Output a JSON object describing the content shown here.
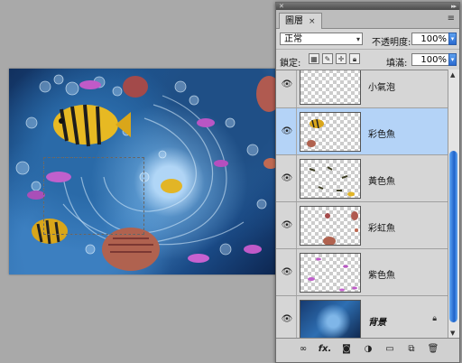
{
  "panel": {
    "tab_label": "圖層",
    "tab_close": "×",
    "menu_icon": "≡",
    "blend_mode": "正常",
    "opacity_label": "不透明度:",
    "opacity_value": "100%",
    "lock_label": "鎖定:",
    "fill_label": "填滿:",
    "fill_value": "100%"
  },
  "layers": [
    {
      "name": "小氣泡",
      "visible": true,
      "selected": false,
      "type": "transparent"
    },
    {
      "name": "彩色魚",
      "visible": true,
      "selected": true,
      "type": "transparent"
    },
    {
      "name": "黃色魚",
      "visible": true,
      "selected": false,
      "type": "transparent"
    },
    {
      "name": "彩虹魚",
      "visible": true,
      "selected": false,
      "type": "transparent"
    },
    {
      "name": "紫色魚",
      "visible": true,
      "selected": false,
      "type": "transparent"
    },
    {
      "name": "背景",
      "visible": true,
      "selected": false,
      "type": "background",
      "locked": true
    }
  ],
  "icons": {
    "eye": "eye-icon",
    "lock": "lock-icon",
    "link": "link-icon",
    "fx": "fx-icon",
    "mask": "mask-icon",
    "adjustment": "adjustment-icon",
    "group": "folder-icon",
    "new_layer": "new-layer-icon",
    "trash": "trash-icon"
  },
  "footer": {
    "fx_label": "fx."
  },
  "colors": {
    "selected_row": "#b4d3f7",
    "scroll_accent": "#2a6ad0"
  }
}
